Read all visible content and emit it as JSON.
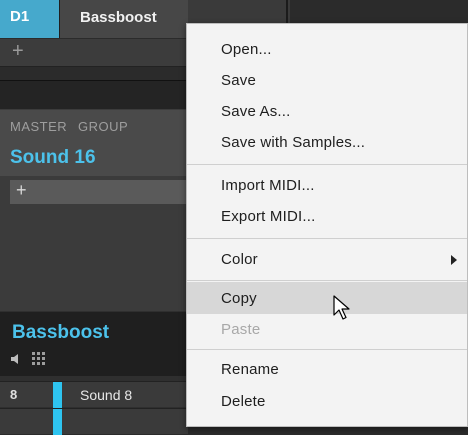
{
  "group_row": {
    "slot_label": "D1",
    "group_name": "Bassboost",
    "add_symbol": "+"
  },
  "sound_header": {
    "tab_master": "MASTER",
    "tab_group": "GROUP",
    "sound_title": "Sound 16",
    "add_symbol": "+"
  },
  "group_panel": {
    "title": "Bassboost",
    "icons": [
      "speaker-icon",
      "grid-icon"
    ],
    "rows": [
      {
        "number": "8",
        "name": "Sound 8"
      }
    ]
  },
  "context_menu": {
    "items": [
      {
        "label": "Open...",
        "enabled": true
      },
      {
        "label": "Save",
        "enabled": true
      },
      {
        "label": "Save As...",
        "enabled": true
      },
      {
        "label": "Save with Samples...",
        "enabled": true
      },
      {
        "label": "Import MIDI...",
        "enabled": true
      },
      {
        "label": "Export MIDI...",
        "enabled": true
      },
      {
        "label": "Color",
        "enabled": true,
        "submenu": true
      },
      {
        "label": "Copy",
        "enabled": true,
        "hovered": true
      },
      {
        "label": "Paste",
        "enabled": false
      },
      {
        "label": "Rename",
        "enabled": true
      },
      {
        "label": "Delete",
        "enabled": true
      }
    ]
  },
  "colors": {
    "accent": "#4cc2eb",
    "group_slot": "#46a9cc",
    "menu_bg": "#f3f3f3",
    "menu_hover": "#d7d7d7",
    "disabled_text": "#a8a8a8"
  }
}
